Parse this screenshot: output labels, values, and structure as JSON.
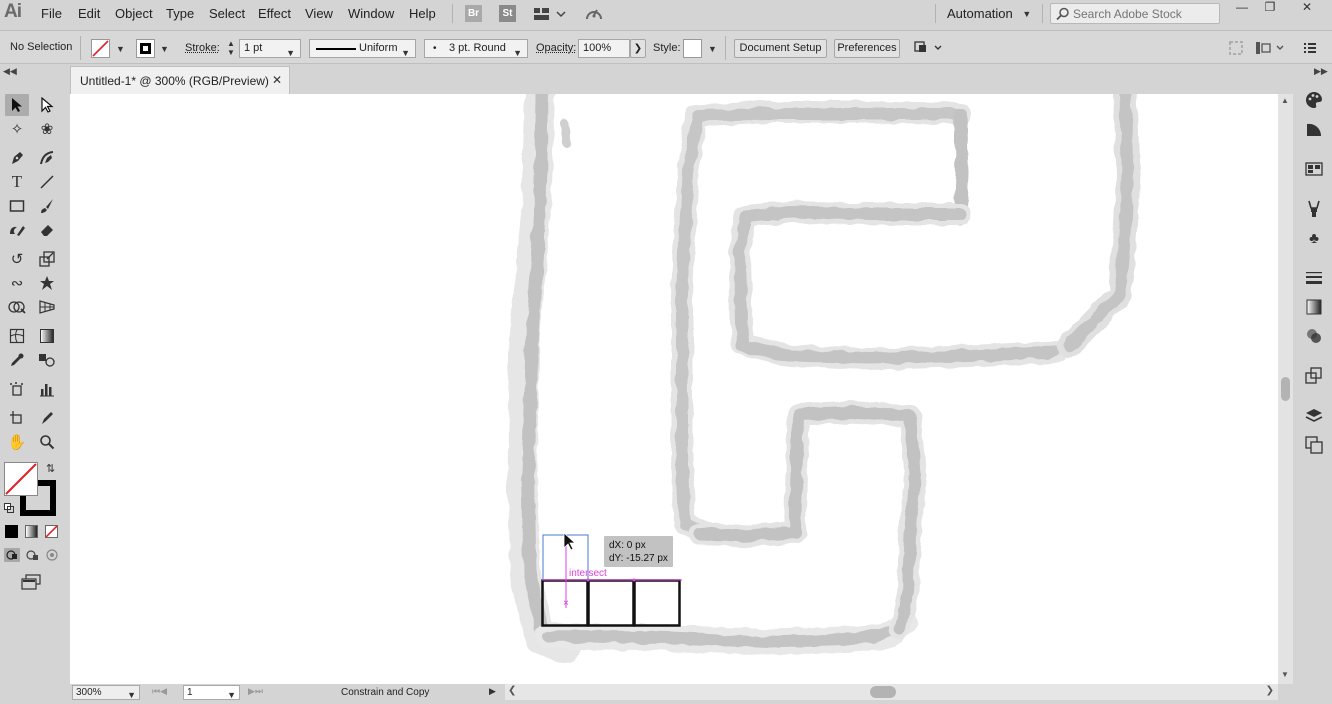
{
  "app": {
    "logo": "Ai"
  },
  "menu": [
    "File",
    "Edit",
    "Object",
    "Type",
    "Select",
    "Effect",
    "View",
    "Window",
    "Help"
  ],
  "menubar_icons": {
    "bridge": "Br",
    "stock": "St"
  },
  "workspace": {
    "label": "Automation"
  },
  "search": {
    "placeholder": "Search Adobe Stock"
  },
  "window_controls": {
    "minimize": "—",
    "restore": "❐",
    "close": "✕"
  },
  "control_bar": {
    "selection_status": "No Selection",
    "stroke_label": "Stroke:",
    "stroke_weight": "1 pt",
    "profile": "Uniform",
    "brush": "3 pt. Round",
    "opacity_label": "Opacity:",
    "opacity_value": "100%",
    "style_label": "Style:",
    "document_setup": "Document Setup",
    "preferences": "Preferences"
  },
  "document": {
    "tab_title": "Untitled-1* @ 300% (RGB/Preview)",
    "close_glyph": "✕"
  },
  "canvas": {
    "tooltip_dx": "dX: 0 px",
    "tooltip_dy": "dY: -15.27 px",
    "smart_guide": "intersect"
  },
  "status_bar": {
    "zoom": "300%",
    "artboard": "1",
    "status_text": "Constrain and Copy"
  },
  "colors": {
    "accent_guide": "#e040e0",
    "selection_blue": "#4a78d6",
    "sketch_gray": "#bdbdbd"
  },
  "icons": {
    "tools": [
      "selection-tool",
      "direct-selection-tool",
      "magic-wand-tool",
      "lasso-tool",
      "pen-tool",
      "curvature-tool",
      "type-tool",
      "line-tool",
      "rectangle-tool",
      "paintbrush-tool",
      "shaper-tool",
      "eraser-tool",
      "rotate-tool",
      "scale-tool",
      "warp-tool",
      "puppet-warp-tool",
      "shape-builder-tool",
      "perspective-grid-tool",
      "mesh-tool",
      "gradient-tool",
      "eyedropper-tool",
      "blend-tool",
      "symbol-sprayer-tool",
      "column-graph-tool",
      "artboard-tool",
      "slice-tool",
      "hand-tool",
      "zoom-tool"
    ],
    "right_panel": [
      "color-panel-icon",
      "color-guide-icon",
      "swatches-icon",
      "brushes-icon",
      "symbols-icon",
      "stroke-icon",
      "gradient-icon",
      "transparency-icon",
      "appearance-icon",
      "layers-icon",
      "artboards-icon"
    ]
  }
}
